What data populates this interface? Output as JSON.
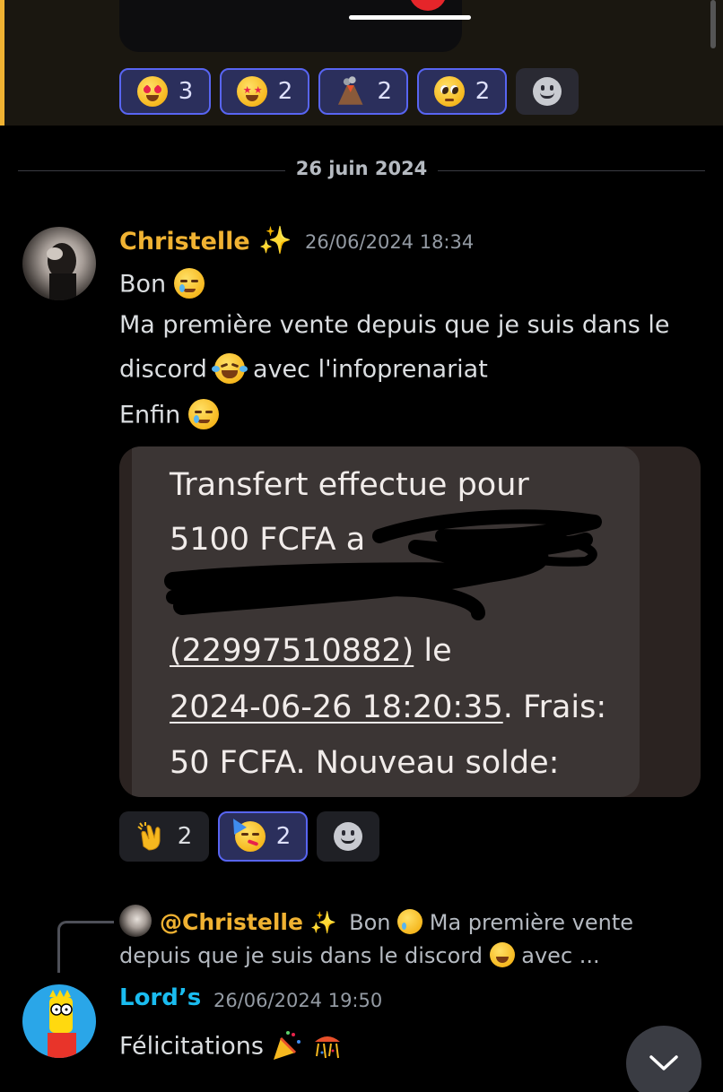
{
  "top_reactions": [
    {
      "emoji": "heart-eyes",
      "count": "3",
      "active": true
    },
    {
      "emoji": "star-struck",
      "count": "2",
      "active": true
    },
    {
      "emoji": "volcano",
      "count": "2",
      "active": true
    },
    {
      "emoji": "pleading-face",
      "count": "2",
      "active": true
    }
  ],
  "date_divider": "26 juin 2024",
  "message1": {
    "username": "Christelle",
    "username_color": "#f0b232",
    "timestamp": "26/06/2024 18:34",
    "line1": "Bon",
    "line2": "Ma première vente depuis que je suis dans le",
    "line3a": "discord",
    "line3b": "avec l'infoprenariat",
    "line4": "Enfin",
    "attachment": {
      "line1": "Transfert effectue pour",
      "line2": "5100 FCFA  a",
      "line4_link": "(22997510882)",
      "line4_rest": " le",
      "line5_link": "2024-06-26 18:20:35",
      "line5_rest": ". Frais:",
      "line6": "50 FCFA. Nouveau solde:"
    },
    "reactions": [
      {
        "emoji": "clapping-hands",
        "count": "2",
        "active": false
      },
      {
        "emoji": "partying-face",
        "count": "2",
        "active": true
      }
    ]
  },
  "reply": {
    "mention": "@Christelle",
    "preview_part1": "Bon",
    "preview_part2": "Ma première vente",
    "preview_line2a": "depuis que je suis dans le discord",
    "preview_line2b": "avec ..."
  },
  "message2": {
    "username": "Lord’s",
    "username_color": "#1abcf0",
    "timestamp": "26/06/2024 19:50",
    "text": "Félicitations"
  }
}
